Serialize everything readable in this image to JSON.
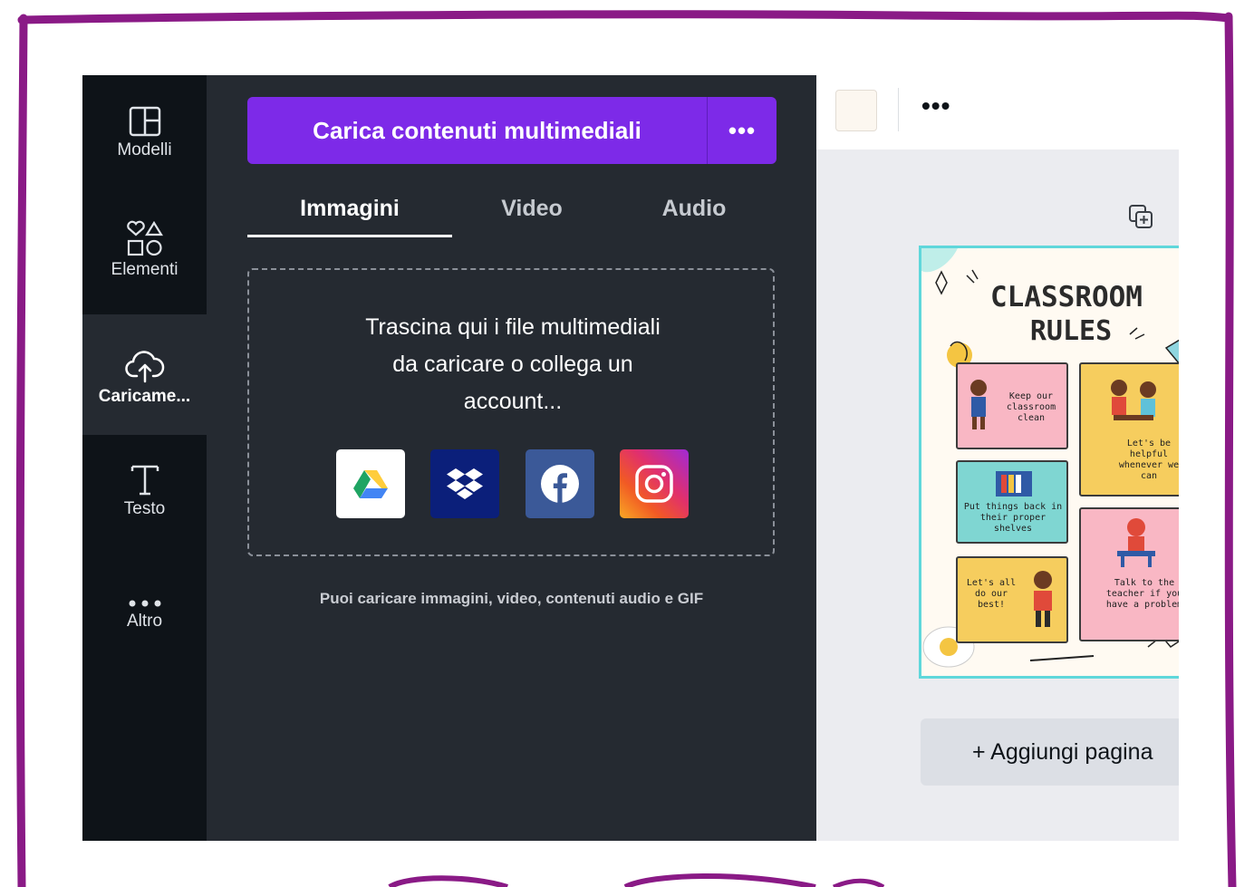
{
  "sidebar": {
    "items": [
      {
        "label": "Modelli",
        "icon": "template-icon"
      },
      {
        "label": "Elementi",
        "icon": "shapes-icon"
      },
      {
        "label": "Caricame...",
        "icon": "cloud-upload-icon"
      },
      {
        "label": "Testo",
        "icon": "text-icon"
      },
      {
        "label": "Altro",
        "icon": "more-dots-icon"
      }
    ],
    "active_index": 2
  },
  "upload": {
    "button_label": "Carica contenuti multimediali",
    "more_label": "•••"
  },
  "tabs": [
    {
      "label": "Immagini",
      "active": true
    },
    {
      "label": "Video",
      "active": false
    },
    {
      "label": "Audio",
      "active": false
    }
  ],
  "dropzone": {
    "line1": "Trascina qui i file multimediali",
    "line2": "da caricare o collega un",
    "line3": "account...",
    "sources": [
      "google-drive-icon",
      "dropbox-icon",
      "facebook-icon",
      "instagram-icon"
    ]
  },
  "hint": "Puoi caricare immagini, video, contenuti audio e GIF",
  "toolbar": {
    "more_label": "•••",
    "swatch_color": "#fcf7f0"
  },
  "poster": {
    "title_line1": "CLASSROOM",
    "title_line2": "RULES",
    "rules": [
      "Keep our classroom clean",
      "Let's be helpful whenever we can",
      "Put things back in their proper shelves",
      "Talk to the teacher if you have a problem",
      "Let's all do our best!"
    ]
  },
  "canvas": {
    "add_page_label": "+ Aggiungi pagina"
  },
  "colors": {
    "accent": "#7d2ae8",
    "frame": "#8a1a86",
    "rail": "#0e1318",
    "panel": "#252a31"
  }
}
